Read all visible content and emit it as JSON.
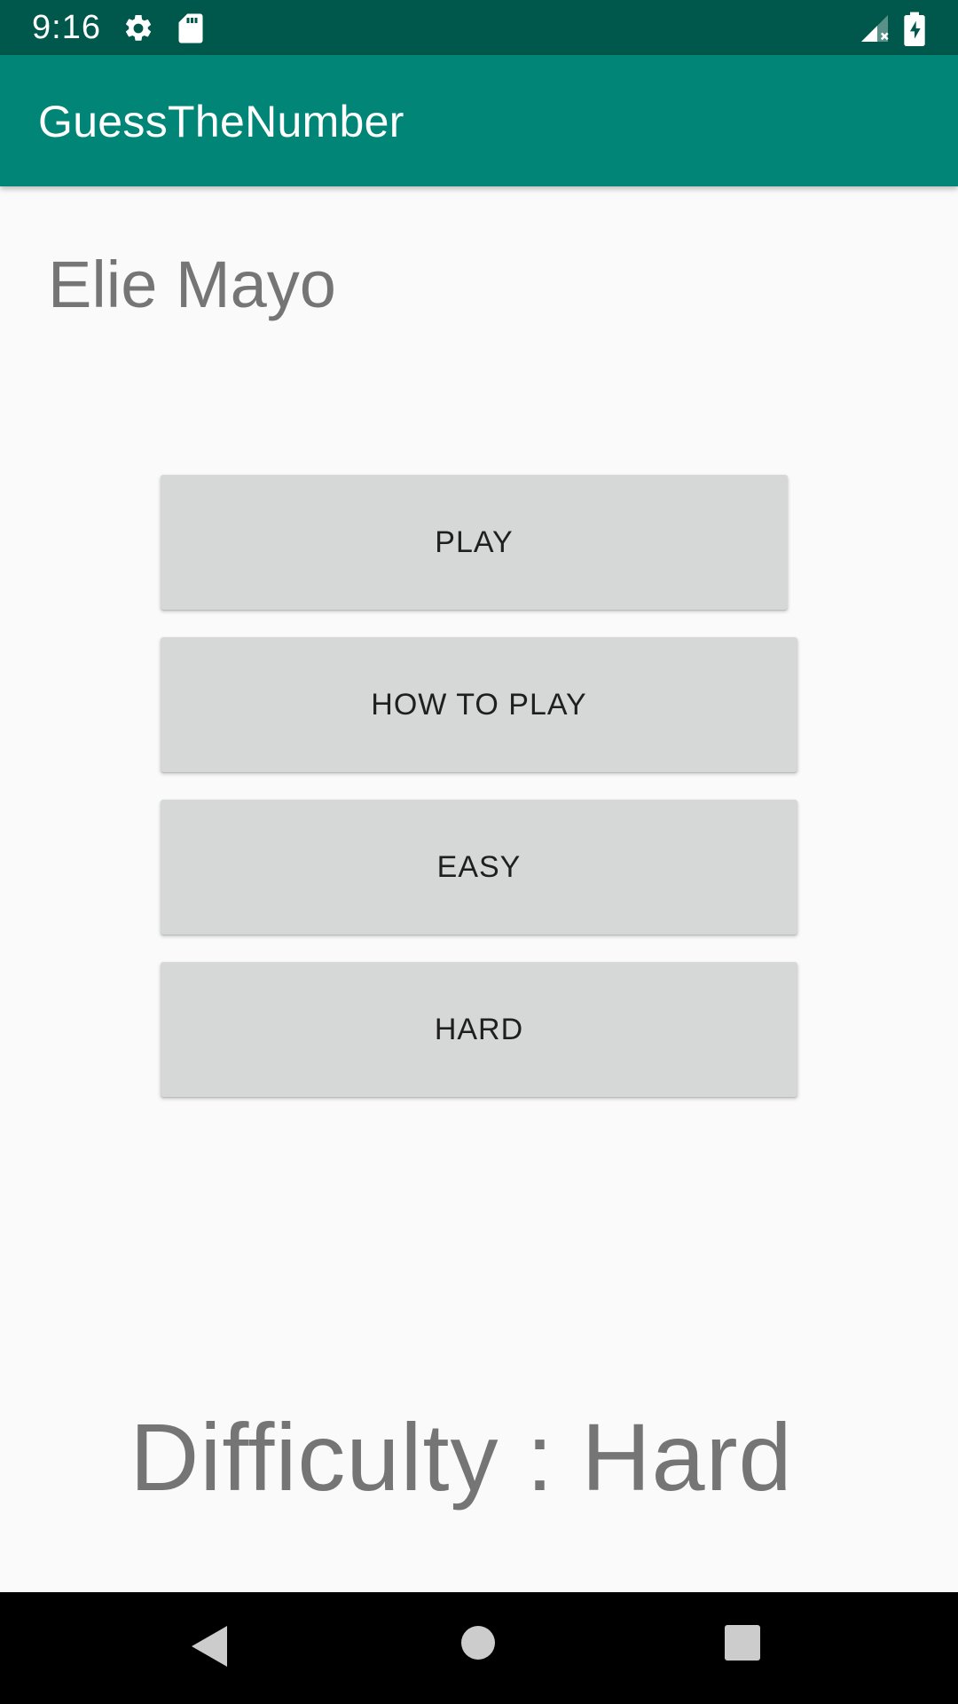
{
  "status_bar": {
    "time": "9:16",
    "icons": [
      "settings-icon",
      "sd-card-icon",
      "signal-icon",
      "battery-charging-icon"
    ],
    "background": "#00574b"
  },
  "app_bar": {
    "title": "GuessTheNumber",
    "background": "#008577"
  },
  "main": {
    "name": "Elie Mayo",
    "buttons": {
      "play": "PLAY",
      "how_to_play": "HOW TO PLAY",
      "easy": "EASY",
      "hard": "HARD"
    },
    "difficulty": "Difficulty : Hard"
  },
  "nav_bar": {
    "buttons": [
      "back-icon",
      "home-icon",
      "recents-icon"
    ]
  }
}
